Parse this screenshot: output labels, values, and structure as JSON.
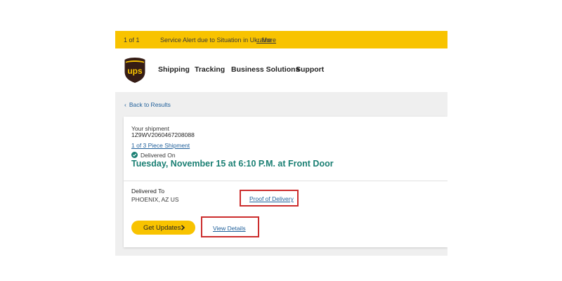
{
  "alert": {
    "count": "1 of 1",
    "text": "Service Alert due to Situation in Ukraine",
    "more": "...More"
  },
  "header": {
    "logo_icon": "ups-shield-logo",
    "nav": [
      "Shipping",
      "Tracking",
      "Business Solutions",
      "Support"
    ]
  },
  "back_link": "Back to Results",
  "shipment": {
    "label": "Your shipment",
    "tracking_number": "1Z9WV2060467208088",
    "piece_link": "1 of 3 Piece Shipment",
    "status_label": "Delivered On",
    "delivered_date": "Tuesday, November 15 at 6:10 P.M. at Front Door",
    "delivered_to_label": "Delivered To",
    "delivered_to_value": "PHOENIX, AZ US",
    "proof_link": "Proof of Delivery",
    "get_updates_label": "Get Updates",
    "view_details_link": "View Details"
  },
  "colors": {
    "brand_yellow": "#f8c300",
    "ups_brown": "#351c15",
    "status_green": "#1a7f73",
    "link_blue": "#1f5f9a",
    "highlight_red": "#cc2d2d"
  }
}
